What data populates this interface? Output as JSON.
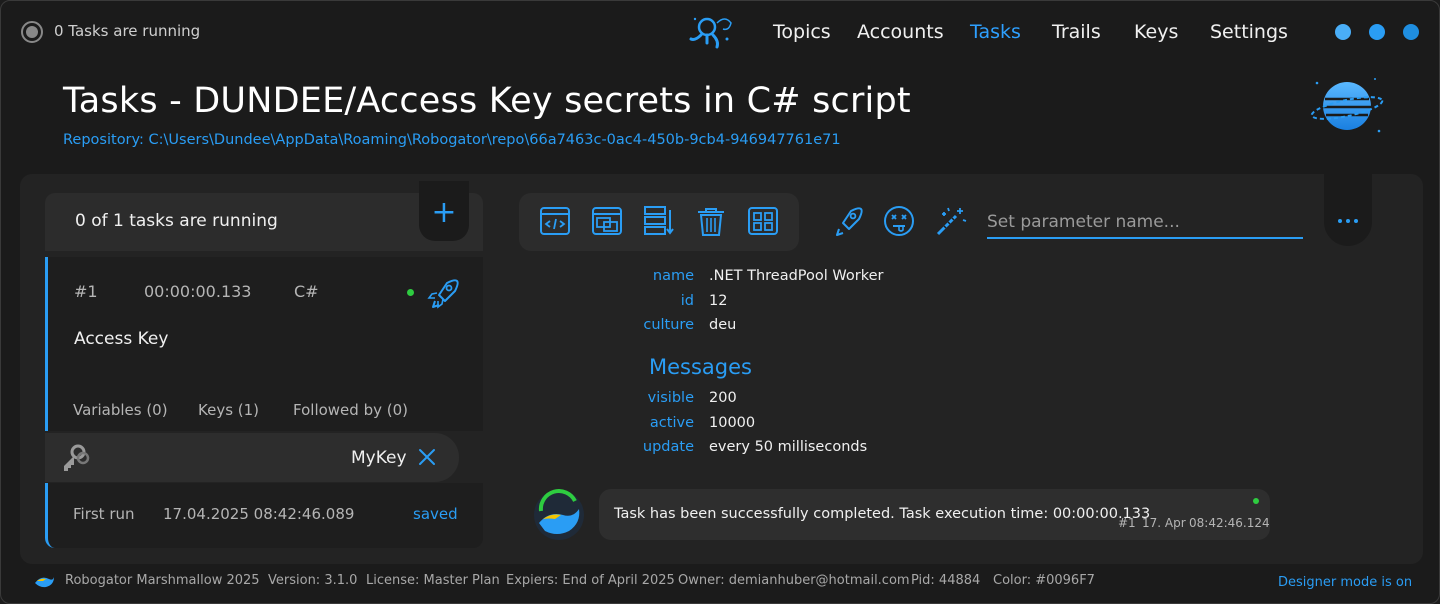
{
  "header": {
    "status_text": "0 Tasks are running",
    "nav": [
      "Topics",
      "Accounts",
      "Tasks",
      "Trails",
      "Keys",
      "Settings"
    ],
    "active_nav": "Tasks",
    "logo_icon": "astronaut-icon"
  },
  "page": {
    "title": "Tasks - DUNDEE/Access Key secrets in C# script",
    "repository": "Repository: C:\\Users\\Dundee\\AppData\\Roaming\\Robogator\\repo\\66a7463c-0ac4-450b-9cb4-946947761e71"
  },
  "tasks": {
    "header_label": "0 of 1 tasks are running",
    "add_icon": "plus-icon",
    "item": {
      "number": "#1",
      "duration": "00:00:00.133",
      "language": "C#",
      "name": "Access Key",
      "tabs": [
        "Variables (0)",
        "Keys (1)",
        "Followed by (0)"
      ],
      "key_name": "MyKey",
      "first_run_label": "First run",
      "first_run_date": "17.04.2025 08:42:46.089",
      "state": "saved"
    }
  },
  "toolbar": {
    "icons": [
      "code-window-icon",
      "windows-icon",
      "sort-list-icon",
      "trash-icon",
      "grid-layout-icon"
    ],
    "actions": [
      "rocket-icon",
      "dizzy-face-icon",
      "magic-wand-icon"
    ],
    "param_placeholder": "Set parameter name..."
  },
  "properties": {
    "thread": [
      {
        "key": "name",
        "value": ".NET ThreadPool Worker"
      },
      {
        "key": "id",
        "value": "12"
      },
      {
        "key": "culture",
        "value": "deu"
      }
    ],
    "messages_title": "Messages",
    "messages": [
      {
        "key": "visible",
        "value": "200"
      },
      {
        "key": "active",
        "value": "10000"
      },
      {
        "key": "update",
        "value": "every 50 milliseconds"
      }
    ]
  },
  "message": {
    "text": "Task has been successfully completed. Task execution time: 00:00:00.133",
    "task": "#1",
    "date": "17. Apr",
    "time": "08:42:46.124"
  },
  "footer": {
    "product": "Robogator Marshmallow 2025",
    "version": "Version: 3.1.0",
    "license": "License: Master Plan",
    "expires": "Expiers: End of April 2025",
    "owner": "Owner: demianhuber@hotmail.com",
    "pid": "Pid: 44884",
    "color": "Color: #0096F7",
    "designer": "Designer mode is on"
  },
  "colors": {
    "accent": "#2a9df4",
    "background": "#1b1b1b",
    "panel": "#232323",
    "running": "#2ecc40"
  }
}
